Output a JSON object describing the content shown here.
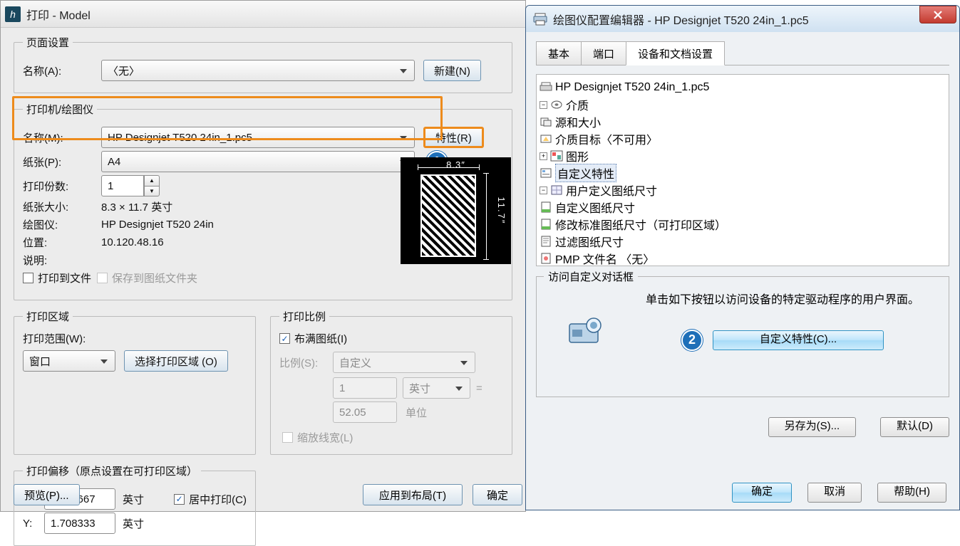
{
  "left": {
    "titlebar": "打印 - Model",
    "page_setup": {
      "legend": "页面设置",
      "name_label": "名称(A):",
      "name_value": "〈无〉",
      "new_btn": "新建(N)"
    },
    "printer": {
      "legend": "打印机/绘图仪",
      "name_label": "名称(M):",
      "name_value": "HP Designjet T520 24in_1.pc5",
      "props_btn": "特性(R)",
      "paper_label": "纸张(P):",
      "paper_value": "A4",
      "copies_label": "打印份数:",
      "copies_value": "1",
      "size_label": "纸张大小:",
      "size_value": "8.3 × 11.7  英寸",
      "plotter_label": "绘图仪:",
      "plotter_value": "HP Designjet T520 24in",
      "location_label": "位置:",
      "location_value": "10.120.48.16",
      "desc_label": "说明:",
      "print_to_file": "打印到文件",
      "save_to_folder": "保存到图纸文件夹",
      "preview_w": "8.3″",
      "preview_h": "11.7″"
    },
    "area": {
      "legend": "打印区域",
      "range_label": "打印范围(W):",
      "range_value": "窗口",
      "select_btn": "选择打印区域 (O)"
    },
    "scale": {
      "legend": "打印比例",
      "fit": "布满图纸(I)",
      "ratio_label": "比例(S):",
      "ratio_value": "自定义",
      "num": "1",
      "unit_sel": "英寸",
      "equals": "=",
      "den": "52.05",
      "unit_txt": "单位",
      "scale_lw": "缩放线宽(L)"
    },
    "offset": {
      "legend": "打印偏移（原点设置在可打印区域）",
      "x_label": "X:",
      "x_val": "0.001667",
      "x_unit": "英寸",
      "y_label": "Y:",
      "y_val": "1.708333",
      "y_unit": "英寸",
      "center": "居中打印(C)"
    },
    "bottom": {
      "preview": "预览(P)...",
      "apply": "应用到布局(T)",
      "ok": "确定"
    },
    "badge1": "1"
  },
  "right": {
    "titlebar": "绘图仪配置编辑器 - HP Designjet T520 24in_1.pc5",
    "tabs": {
      "t1": "基本",
      "t2": "端口",
      "t3": "设备和文档设置"
    },
    "tree": {
      "root": "HP Designjet T520 24in_1.pc5",
      "media": "介质",
      "media_src": "源和大小",
      "media_tgt": "介质目标〈不可用〉",
      "graphics": "图形",
      "custom_props": "自定义特性",
      "user_sizes": "用户定义图纸尺寸",
      "us_custom": "自定义图纸尺寸",
      "us_modify": "修改标准图纸尺寸（可打印区域）",
      "us_filter": "过滤图纸尺寸",
      "pmp": "PMP 文件名 〈无〉"
    },
    "group": {
      "title": "访问自定义对话框",
      "hint": "单击如下按钮以访问设备的特定驱动程序的用户界面。",
      "btn": "自定义特性(C)..."
    },
    "saveas": "另存为(S)...",
    "default": "默认(D)",
    "ok": "确定",
    "cancel": "取消",
    "help": "帮助(H)",
    "badge2": "2"
  }
}
